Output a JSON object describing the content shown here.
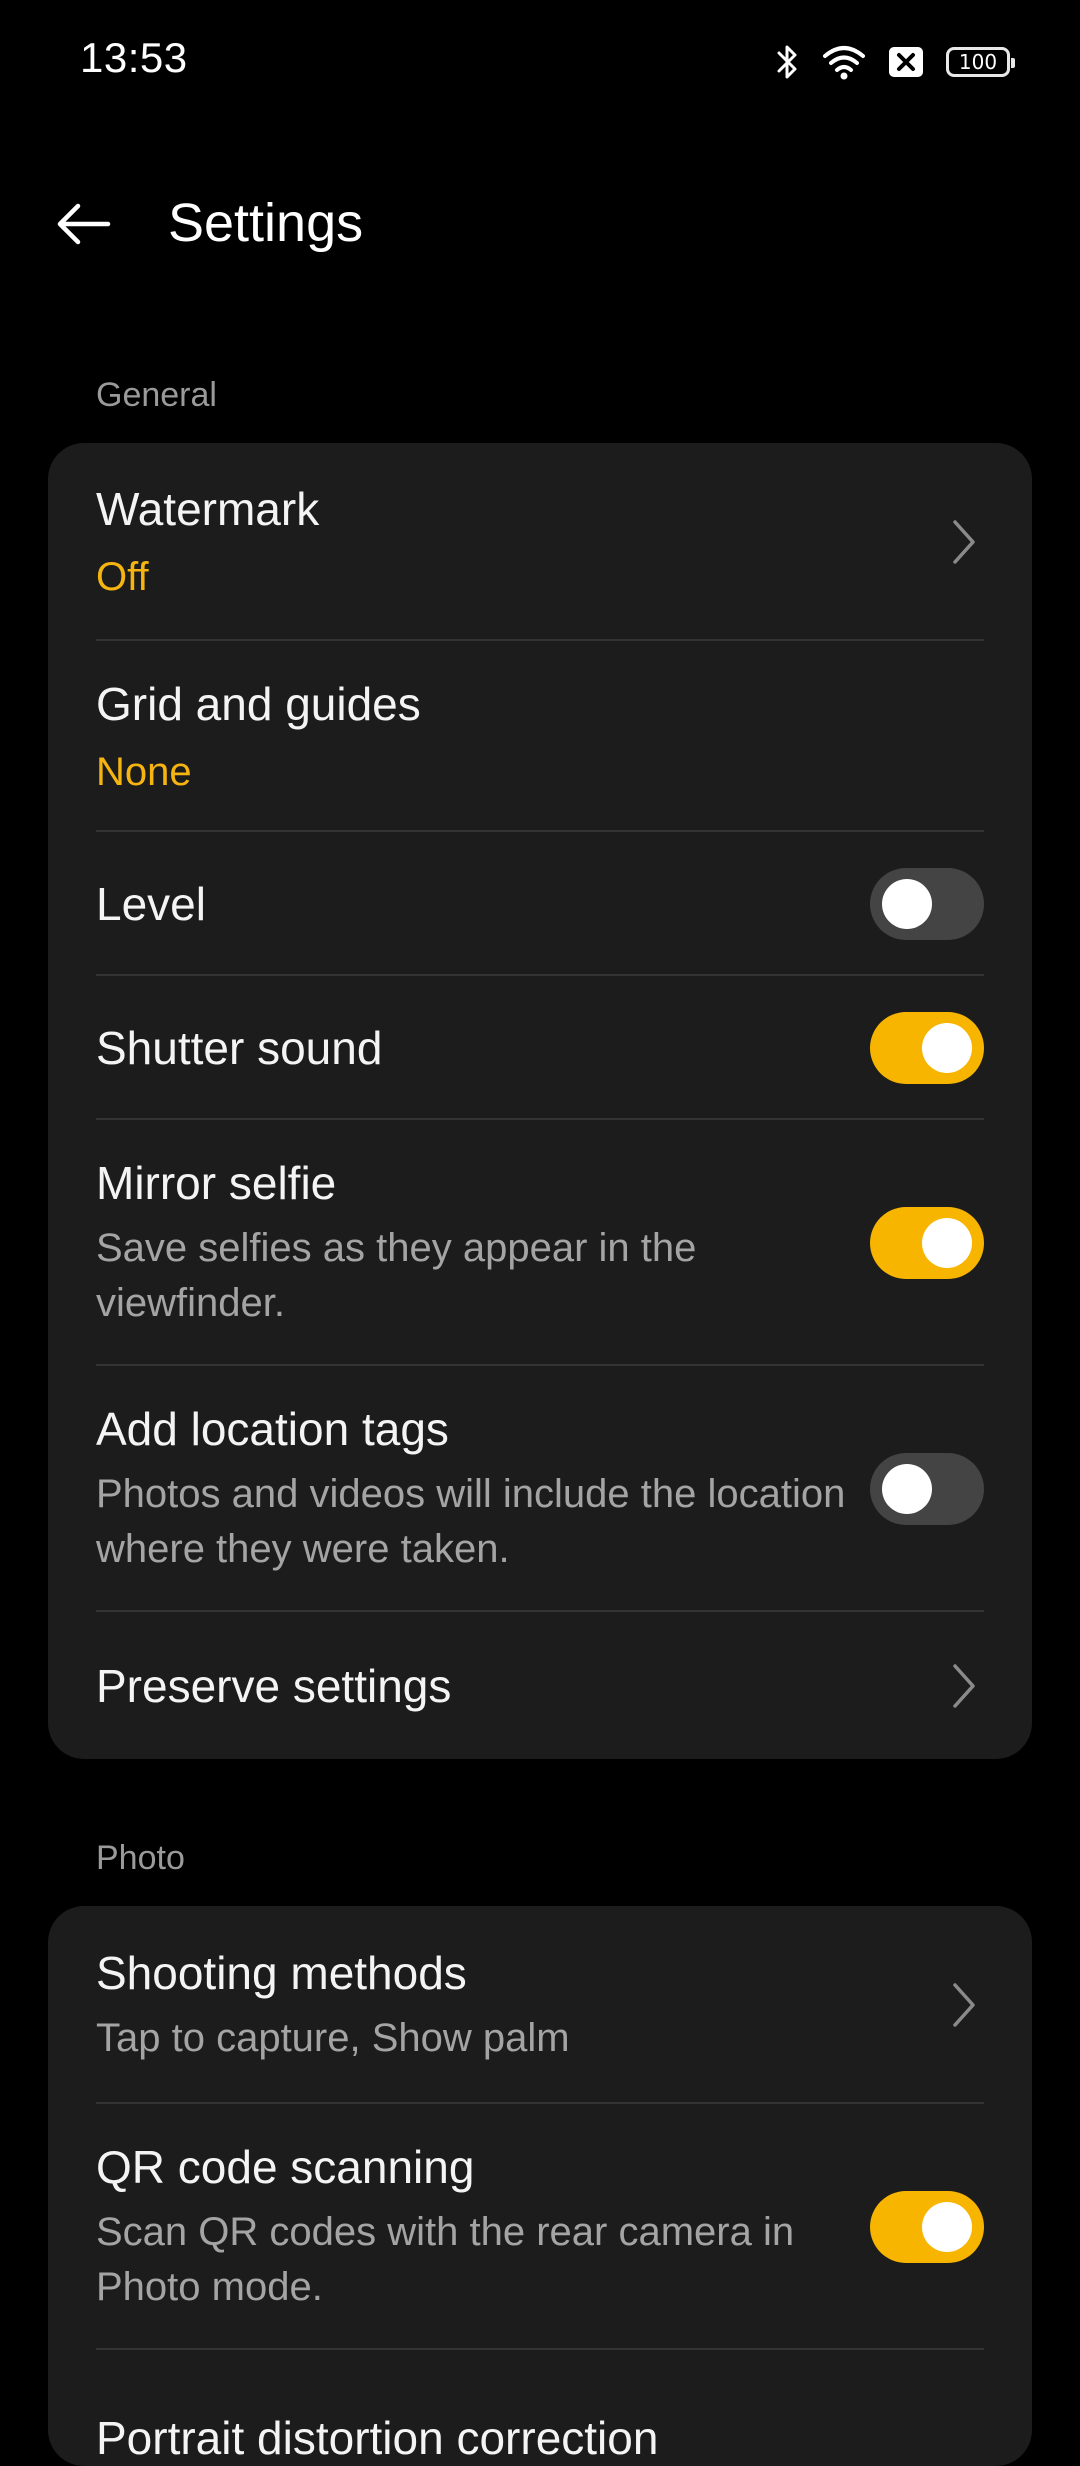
{
  "status_bar": {
    "time": "13:53",
    "icons": [
      "bluetooth-icon",
      "wifi-icon",
      "sim-off-icon",
      "battery-icon"
    ],
    "battery_level": "100"
  },
  "header": {
    "title": "Settings",
    "back_icon": "arrow-left-icon"
  },
  "colors": {
    "accent": "#f8b500",
    "value_text": "#f5b40f",
    "card_bg": "#1c1c1c",
    "toggle_off": "#444444"
  },
  "sections": [
    {
      "label": "General",
      "items": [
        {
          "title": "Watermark",
          "value": "Off",
          "control": "chevron"
        },
        {
          "title": "Grid and guides",
          "value": "None",
          "control": "none"
        },
        {
          "title": "Level",
          "control": "toggle",
          "state": false
        },
        {
          "title": "Shutter sound",
          "control": "toggle",
          "state": true
        },
        {
          "title": "Mirror selfie",
          "description": "Save selfies as they appear in the viewfinder.",
          "control": "toggle",
          "state": true
        },
        {
          "title": "Add location tags",
          "description": "Photos and videos will include the location where they were taken.",
          "control": "toggle",
          "state": false
        },
        {
          "title": "Preserve settings",
          "control": "chevron"
        }
      ]
    },
    {
      "label": "Photo",
      "items": [
        {
          "title": "Shooting methods",
          "description": "Tap to capture, Show palm",
          "control": "chevron"
        },
        {
          "title": "QR code scanning",
          "description": "Scan QR codes with the rear camera in Photo mode.",
          "control": "toggle",
          "state": true
        },
        {
          "title": "Portrait distortion correction",
          "control": "unknown"
        }
      ]
    }
  ]
}
